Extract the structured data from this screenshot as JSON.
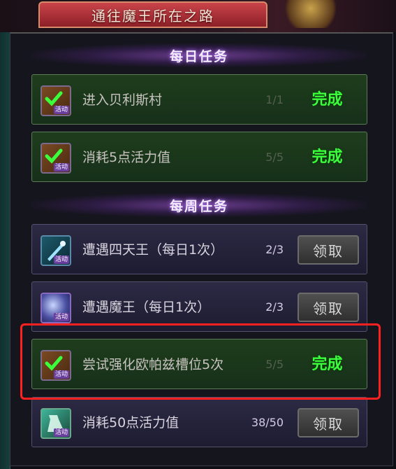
{
  "header": {
    "banner_title": "通往魔王所在之路"
  },
  "sections": {
    "daily_title": "每日任务",
    "weekly_title": "每周任务"
  },
  "daily_tasks": [
    {
      "label": "进入贝利斯村",
      "progress": "1/1",
      "status": "完成",
      "icon": "chest-check-icon",
      "tag": "活动"
    },
    {
      "label": "消耗5点活力值",
      "progress": "5/5",
      "status": "完成",
      "icon": "chest-check-icon",
      "tag": "活动"
    }
  ],
  "weekly_tasks": [
    {
      "label": "遭遇四天王（每日1次）",
      "progress": "2/3",
      "action": "领取",
      "icon": "blade-icon",
      "tag": "活动"
    },
    {
      "label": "遭遇魔王（每日1次）",
      "progress": "2/3",
      "action": "领取",
      "icon": "orb-icon",
      "tag": "活动"
    },
    {
      "label": "尝试强化欧帕兹槽位5次",
      "progress": "5/5",
      "status": "完成",
      "icon": "chest-check-icon",
      "tag": "活动"
    },
    {
      "label": "消耗50点活力值",
      "progress": "38/50",
      "action": "领取",
      "icon": "potion-icon",
      "tag": "活动"
    }
  ],
  "colors": {
    "complete_green": "#3cff3c",
    "highlight_red": "#ff2020",
    "section_glow": "#b77cff"
  }
}
